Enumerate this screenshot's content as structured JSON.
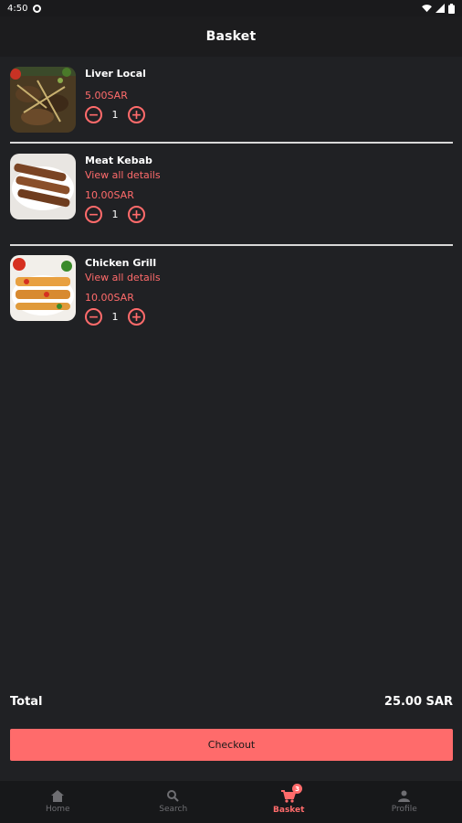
{
  "status_bar": {
    "time": "4:50"
  },
  "app_bar": {
    "title": "Basket"
  },
  "items": [
    {
      "name": "Liver Local",
      "details": "",
      "price": "5.00SAR",
      "quantity": "1"
    },
    {
      "name": "Meat Kebab",
      "details": "View all details",
      "price": "10.00SAR",
      "quantity": "1"
    },
    {
      "name": "Chicken Grill",
      "details": "View all details",
      "price": "10.00SAR",
      "quantity": "1"
    }
  ],
  "summary": {
    "total_label": "Total",
    "total_value": "25.00 SAR"
  },
  "checkout": {
    "label": "Checkout"
  },
  "bottom_nav": {
    "items": [
      {
        "label": "Home",
        "icon": "home-icon"
      },
      {
        "label": "Search",
        "icon": "search-icon"
      },
      {
        "label": "Basket",
        "icon": "cart-icon",
        "badge": "3"
      },
      {
        "label": "Profile",
        "icon": "person-icon"
      }
    ]
  },
  "colors": {
    "accent": "#ff6b6b",
    "background": "#202124",
    "bar": "#1c1c1e"
  }
}
